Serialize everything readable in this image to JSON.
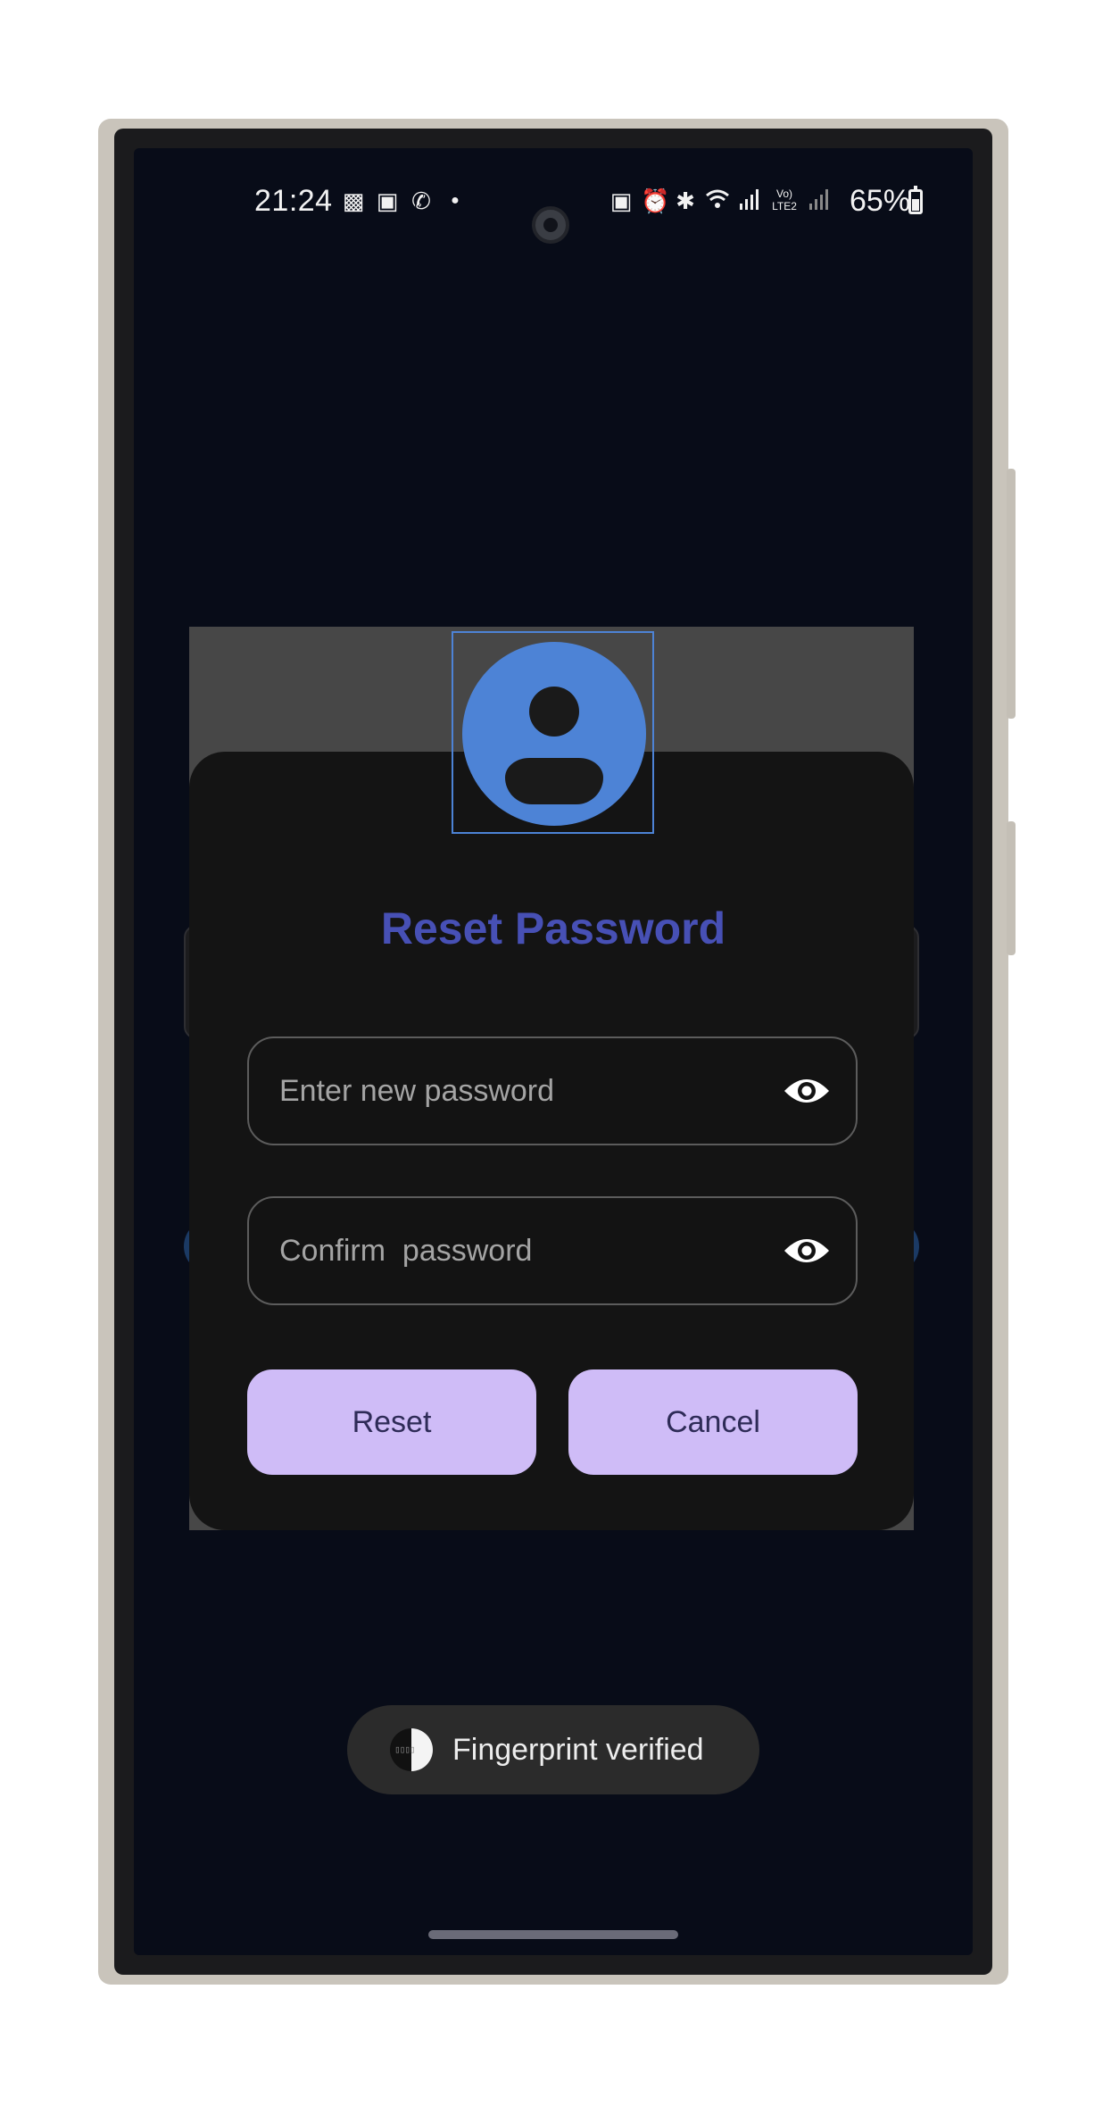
{
  "status_bar": {
    "time": "21:24",
    "battery": "65%",
    "left_icons": [
      "gallery-icon",
      "screen-cast-icon",
      "whatsapp-icon",
      "dot-icon"
    ],
    "right_icons": [
      "battery-saver-icon",
      "alarm-icon",
      "bluetooth-icon",
      "wifi-icon",
      "signal-icon",
      "volte-icon",
      "signal-icon-2"
    ]
  },
  "dialog": {
    "title": "Reset Password",
    "new_password_placeholder": "Enter new password",
    "confirm_password_placeholder": "Confirm  password",
    "reset_label": "Reset",
    "cancel_label": "Cancel"
  },
  "toast": {
    "text": "Fingerprint verified"
  },
  "colors": {
    "accent": "#4d83d6",
    "title": "#4750b5",
    "button": "#cfbcf7",
    "screen_bg": "#080c18"
  }
}
